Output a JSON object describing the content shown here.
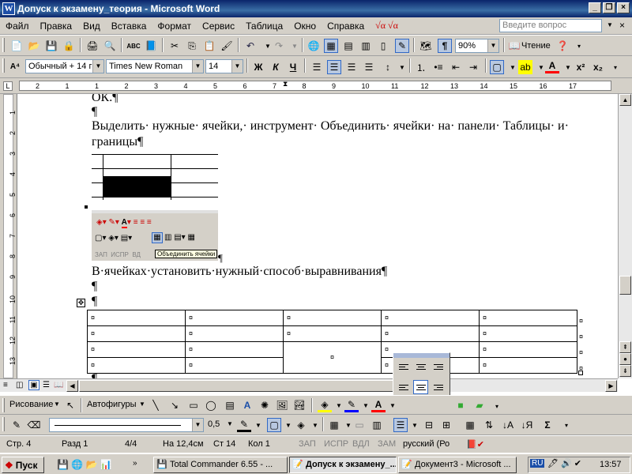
{
  "window": {
    "title": "Допуск к экзамену_теория - Microsoft Word"
  },
  "menu": {
    "items": [
      "Файл",
      "Правка",
      "Вид",
      "Вставка",
      "Формат",
      "Сервис",
      "Таблица",
      "Окно",
      "Справка"
    ],
    "help_placeholder": "Введите вопрос"
  },
  "toolbar_standard": {
    "zoom": "90%",
    "read_label": "Чтение"
  },
  "toolbar_format": {
    "style": "Обычный + 14 г",
    "font": "Times New Roman",
    "size": "14",
    "bold": "Ж",
    "italic": "К",
    "underline": "Ч",
    "superscript": "x²",
    "subscript": "x₂"
  },
  "ruler": {
    "numbers": [
      "2",
      "1",
      "1",
      "2",
      "3",
      "4",
      "5",
      "6",
      "7",
      "8",
      "9",
      "10",
      "11",
      "12",
      "13",
      "14",
      "15",
      "16",
      "17"
    ]
  },
  "document": {
    "line_ok": "ОК.¶",
    "pilcrow": "¶",
    "para1_line1": "Выделить· нужные· ячейки,· инструмент· Объединить· ячейки· на· панели· Таблицы· и·",
    "para1_line2": "границы¶",
    "inline_screenshot": {
      "status_items": [
        "ЗАП",
        "ИСПР",
        "ВД"
      ],
      "tooltip": "Объединить ячейки"
    },
    "para2": "В·ячейках·установить·нужный·способ·выравнивания¶",
    "table": {
      "rows": 4,
      "cols": 5,
      "cell_mark": "¤"
    }
  },
  "drawing_bar": {
    "draw_label": "Рисование",
    "autoshapes_label": "Автофигуры"
  },
  "tables_bar": {
    "line_weight": "0,5"
  },
  "status": {
    "page": "Стр. 4",
    "section": "Разд 1",
    "pages": "4/4",
    "at": "На 12,4см",
    "line": "Ст 14",
    "col": "Кол 1",
    "rec": "ЗАП",
    "trk": "ИСПР",
    "ext": "ВДЛ",
    "ovr": "ЗАМ",
    "lang": "русский (Ро"
  },
  "taskbar": {
    "start": "Пуск",
    "tasks": [
      "Total Commander 6.55 - ...",
      "Допуск к экзамену_...",
      "Документ3 - Microsoft ..."
    ],
    "lang": "RU",
    "clock": "13:57"
  }
}
